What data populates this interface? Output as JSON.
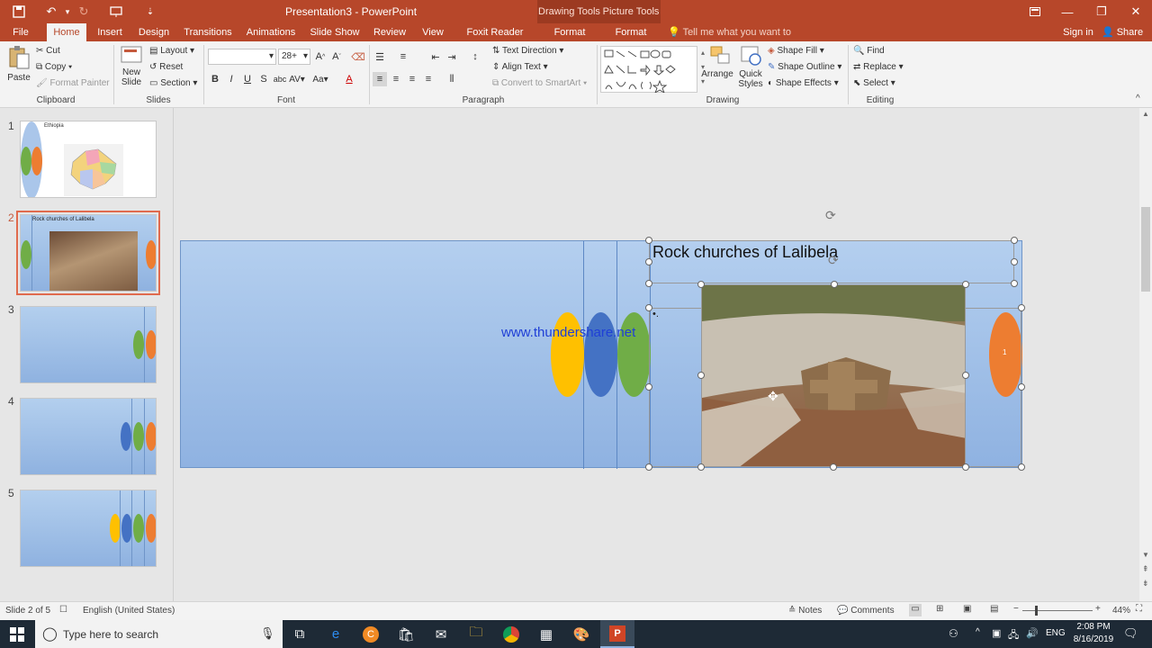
{
  "titlebar": {
    "doc_title": "Presentation3 - PowerPoint",
    "ctx_drawing": "Drawing Tools",
    "ctx_picture": "Picture Tools",
    "icons": [
      "save-icon",
      "undo-icon",
      "redo-icon",
      "present-icon",
      "customize-icon"
    ]
  },
  "tabs": {
    "file": "File",
    "home": "Home",
    "insert": "Insert",
    "design": "Design",
    "transitions": "Transitions",
    "animations": "Animations",
    "slideshow": "Slide Show",
    "review": "Review",
    "view": "View",
    "foxit": "Foxit Reader PDF",
    "format1": "Format",
    "format2": "Format",
    "tellme": "Tell me what you want to do...",
    "signin": "Sign in",
    "share": "Share"
  },
  "ribbon": {
    "clipboard": {
      "paste": "Paste",
      "cut": "Cut",
      "copy": "Copy",
      "format_painter": "Format Painter",
      "label": "Clipboard"
    },
    "slides": {
      "new_slide": "New Slide",
      "layout": "Layout",
      "reset": "Reset",
      "section": "Section",
      "label": "Slides"
    },
    "font": {
      "font_name": "",
      "font_size": "28+",
      "label": "Font"
    },
    "paragraph": {
      "text_direction": "Text Direction",
      "align_text": "Align Text",
      "convert_smartart": "Convert to SmartArt",
      "label": "Paragraph"
    },
    "drawing": {
      "arrange": "Arrange",
      "quick_styles": "Quick Styles",
      "shape_fill": "Shape Fill",
      "shape_outline": "Shape Outline",
      "shape_effects": "Shape Effects",
      "label": "Drawing"
    },
    "editing": {
      "find": "Find",
      "replace": "Replace",
      "select": "Select",
      "label": "Editing"
    }
  },
  "slides_pane": {
    "numbers": [
      "1",
      "2",
      "3",
      "4",
      "5"
    ],
    "thumb1_title": "Ethiopia",
    "thumb2_title": "Rock churches of Lalibela"
  },
  "slide": {
    "title": "Rock churches of Lalibela",
    "watermark": "www.thundershare.net",
    "bullet": "•.",
    "oval_number": "1",
    "colors": {
      "yellow": "#ffc000",
      "blue": "#4472c4",
      "green": "#70ad47",
      "orange": "#ed7d31",
      "bg_top": "#b4cfef",
      "bg_bottom": "#8fb2e1"
    }
  },
  "status": {
    "slide_of": "Slide 2 of 5",
    "language": "English (United States)",
    "notes": "Notes",
    "comments": "Comments",
    "zoom": "44%"
  },
  "taskbar": {
    "search_placeholder": "Type here to search",
    "lang": "ENG",
    "time": "2:08 PM",
    "date": "8/16/2019"
  }
}
